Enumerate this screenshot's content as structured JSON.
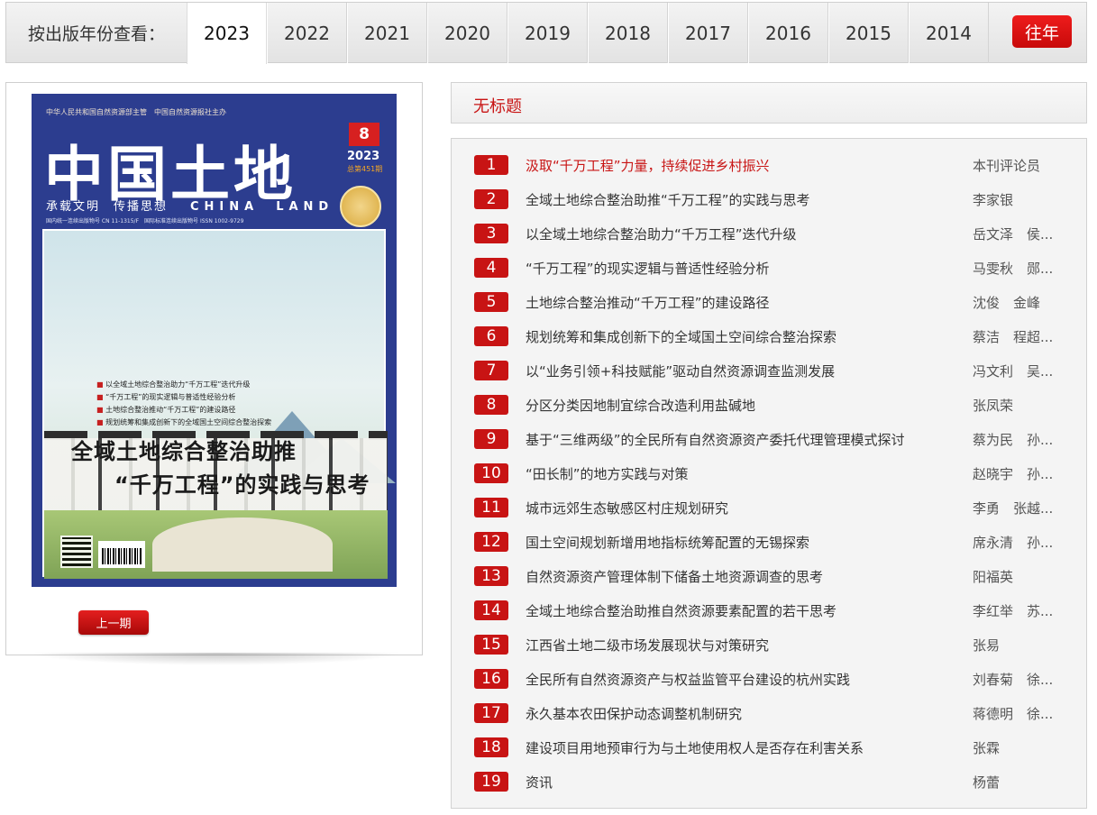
{
  "yearbar": {
    "label": "按出版年份查看：",
    "years": [
      "2023",
      "2022",
      "2021",
      "2020",
      "2019",
      "2018",
      "2017",
      "2016",
      "2015",
      "2014"
    ],
    "active_year": "2023",
    "past_label": "往年"
  },
  "cover": {
    "top_text": "中华人民共和国自然资源部主管　中国自然资源报社主办",
    "title": "中国土地",
    "issue": "8",
    "year": "2023",
    "total_issue": "总第451期",
    "slogan": "承载文明　传播思想",
    "english": "CHINA　LAND",
    "code_line": "国内统一连续出版物号 CN 11-1315/F　国际标准连续出版物号 ISSN 1002-9729",
    "headline_line1": "全域土地综合整治助推",
    "headline_line2": "“千万工程”的实践与思考",
    "bullets": [
      "以全域土地综合整治助力“千万工程”迭代升级",
      "“千万工程”的现实逻辑与普适性经验分析",
      "土地综合整治推动“千万工程”的建设路径",
      "规划统筹和集成创新下的全域国土空间综合整治探索"
    ],
    "prev_label": "上一期"
  },
  "section": {
    "title": "无标题"
  },
  "articles": [
    {
      "num": "1",
      "title": "汲取“千万工程”力量，持续促进乡村振兴",
      "author": "本刊评论员"
    },
    {
      "num": "2",
      "title": "全域土地综合整治助推“千万工程”的实践与思考",
      "author": "李家银"
    },
    {
      "num": "3",
      "title": "以全域土地综合整治助力“千万工程”迭代升级",
      "author": "岳文泽　侯..."
    },
    {
      "num": "4",
      "title": "“千万工程”的现实逻辑与普适性经验分析",
      "author": "马雯秋　郧..."
    },
    {
      "num": "5",
      "title": "土地综合整治推动“千万工程”的建设路径",
      "author": "沈俊　金峰"
    },
    {
      "num": "6",
      "title": "规划统筹和集成创新下的全域国土空间综合整治探索",
      "author": "蔡洁　程超..."
    },
    {
      "num": "7",
      "title": "以“业务引领+科技赋能”驱动自然资源调查监测发展",
      "author": "冯文利　吴..."
    },
    {
      "num": "8",
      "title": "分区分类因地制宜综合改造利用盐碱地",
      "author": "张凤荣"
    },
    {
      "num": "9",
      "title": "基于“三维两级”的全民所有自然资源资产委托代理管理模式探讨",
      "author": "蔡为民　孙..."
    },
    {
      "num": "10",
      "title": "“田长制”的地方实践与对策",
      "author": "赵晓宇　孙..."
    },
    {
      "num": "11",
      "title": "城市远郊生态敏感区村庄规划研究",
      "author": "李勇　张越..."
    },
    {
      "num": "12",
      "title": "国土空间规划新增用地指标统筹配置的无锡探索",
      "author": "席永清　孙..."
    },
    {
      "num": "13",
      "title": "自然资源资产管理体制下储备土地资源调查的思考",
      "author": "阳福英"
    },
    {
      "num": "14",
      "title": "全域土地综合整治助推自然资源要素配置的若干思考",
      "author": "李红举　苏..."
    },
    {
      "num": "15",
      "title": "江西省土地二级市场发展现状与对策研究",
      "author": "张易"
    },
    {
      "num": "16",
      "title": "全民所有自然资源资产与权益监管平台建设的杭州实践",
      "author": "刘春菊　徐..."
    },
    {
      "num": "17",
      "title": "永久基本农田保护动态调整机制研究",
      "author": "蒋德明　徐..."
    },
    {
      "num": "18",
      "title": "建设项目用地预审行为与土地使用权人是否存在利害关系",
      "author": "张霖"
    },
    {
      "num": "19",
      "title": "资讯",
      "author": "杨蕾"
    }
  ],
  "colors": {
    "accent": "#c81414",
    "cover_blue": "#2c3d8f"
  }
}
